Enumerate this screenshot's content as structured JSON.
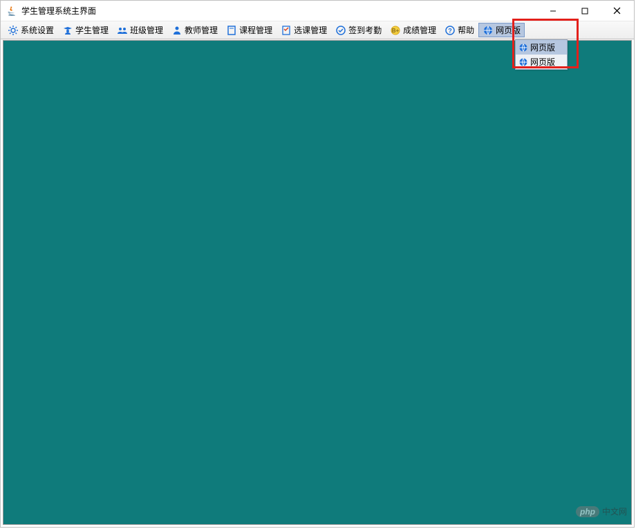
{
  "window": {
    "title": "学生管理系统主界面"
  },
  "menubar": {
    "items": [
      {
        "label": "系统设置",
        "icon": "gear-icon",
        "color": "#1e6fd9"
      },
      {
        "label": "学生管理",
        "icon": "student-icon",
        "color": "#1e6fd9"
      },
      {
        "label": "班级管理",
        "icon": "group-icon",
        "color": "#1e6fd9"
      },
      {
        "label": "教师管理",
        "icon": "teacher-icon",
        "color": "#1e6fd9"
      },
      {
        "label": "课程管理",
        "icon": "book-icon",
        "color": "#1e6fd9"
      },
      {
        "label": "选课管理",
        "icon": "clipboard-icon",
        "color": "#1e6fd9"
      },
      {
        "label": "签到考勤",
        "icon": "check-circle-icon",
        "color": "#1e6fd9"
      },
      {
        "label": "成绩管理",
        "icon": "badge-icon",
        "color": "#d9a71e"
      },
      {
        "label": "帮助",
        "icon": "question-icon",
        "color": "#1e6fd9"
      },
      {
        "label": "网页版",
        "icon": "globe-icon",
        "color": "#1e6fd9",
        "selected": true
      }
    ]
  },
  "dropdown": {
    "items": [
      {
        "label": "网页版",
        "highlighted": true
      },
      {
        "label": "网页版",
        "highlighted": false
      }
    ]
  },
  "colors": {
    "content_bg": "#0f7b7b",
    "highlight_border": "#e3201b"
  },
  "watermark": {
    "logo": "php",
    "text": "中文网"
  }
}
